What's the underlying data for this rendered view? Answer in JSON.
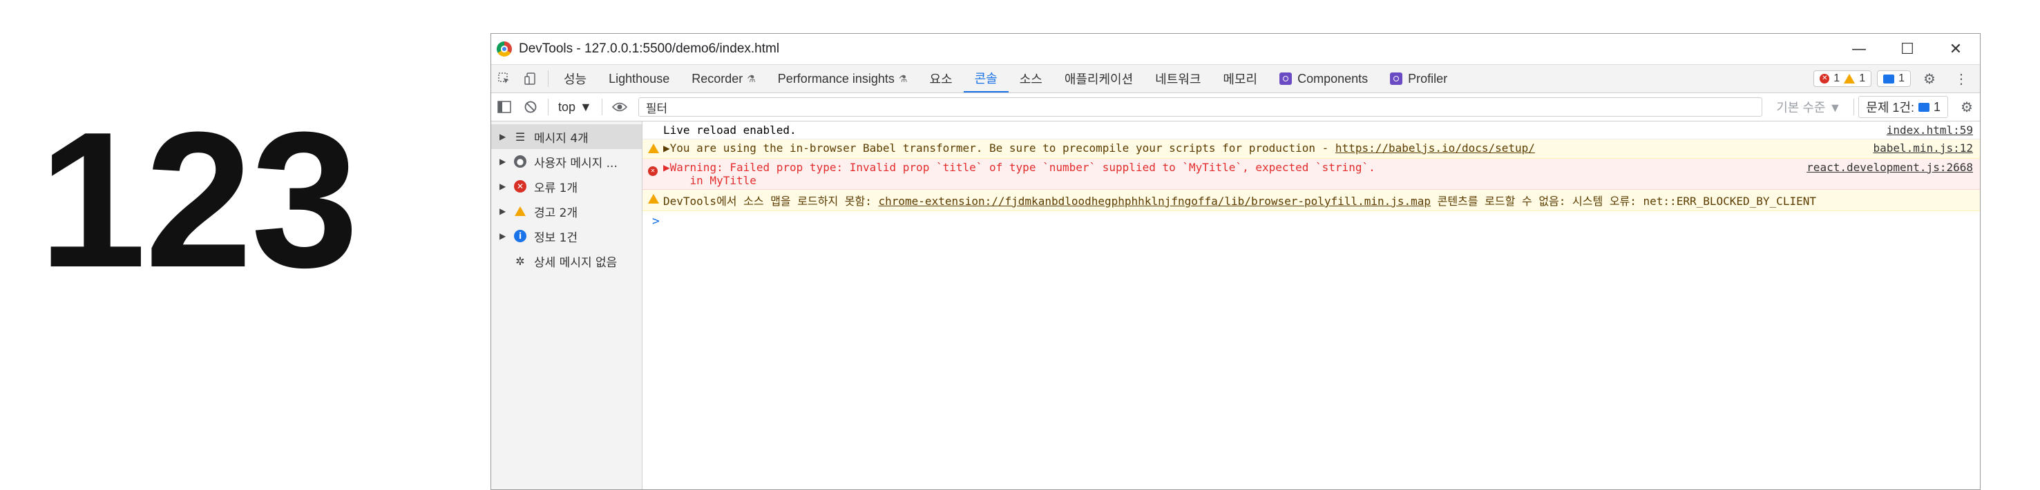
{
  "left_text": "123",
  "window": {
    "title": "DevTools - 127.0.0.1:5500/demo6/index.html",
    "controls": [
      "—",
      "☐",
      "✕"
    ]
  },
  "tabs": [
    {
      "label": "성능"
    },
    {
      "label": "Lighthouse"
    },
    {
      "label": "Recorder"
    },
    {
      "label": "Performance insights"
    },
    {
      "label": "요소"
    },
    {
      "label": "콘솔"
    },
    {
      "label": "소스"
    },
    {
      "label": "애플리케이션"
    },
    {
      "label": "네트워크"
    },
    {
      "label": "메모리"
    },
    {
      "label": "Components"
    },
    {
      "label": "Profiler"
    }
  ],
  "issue_counts": {
    "errors": "1",
    "warnings": "1",
    "messages": "1"
  },
  "console_toolbar": {
    "context": "top",
    "filter_placeholder": "필터",
    "levels": "기본 수준 ▼",
    "issues_label": "문제 1건:",
    "issues_count": "1"
  },
  "sidebar": {
    "items": [
      {
        "label": "메시지 4개"
      },
      {
        "label": "사용자 메시지 ..."
      },
      {
        "label": "오류 1개"
      },
      {
        "label": "경고 2개"
      },
      {
        "label": "정보 1건"
      },
      {
        "label": "상세 메시지 없음"
      }
    ]
  },
  "console": {
    "rows": [
      {
        "level": "log",
        "message": "Live reload enabled.",
        "source": "index.html:59"
      },
      {
        "level": "warn",
        "message": "You are using the in-browser Babel transformer. Be sure to precompile your scripts for production - ",
        "link": "https://babeljs.io/docs/setup/",
        "source": "babel.min.js:12"
      },
      {
        "level": "error",
        "message": "Warning: Failed prop type: Invalid prop `title` of type `number` supplied to `MyTitle`, expected `string`.",
        "message2": "    in MyTitle",
        "source": "react.development.js:2668"
      },
      {
        "level": "warn",
        "message_pre": "DevTools에서 소스 맵을 로드하지 못함: ",
        "link": "chrome-extension://fjdmkanbdloodhegphphhklnjfngoffa/lib/browser-polyfill.min.js.map",
        "message_post": " 콘텐츠를 로드할 수 없음: 시스템 오류: net::ERR_BLOCKED_BY_CLIENT"
      }
    ],
    "prompt": ">"
  },
  "colors": {
    "accent": "#1a73e8",
    "error": "#d93025",
    "warning": "#f2a600",
    "react_icon": "#6a4bc4"
  }
}
